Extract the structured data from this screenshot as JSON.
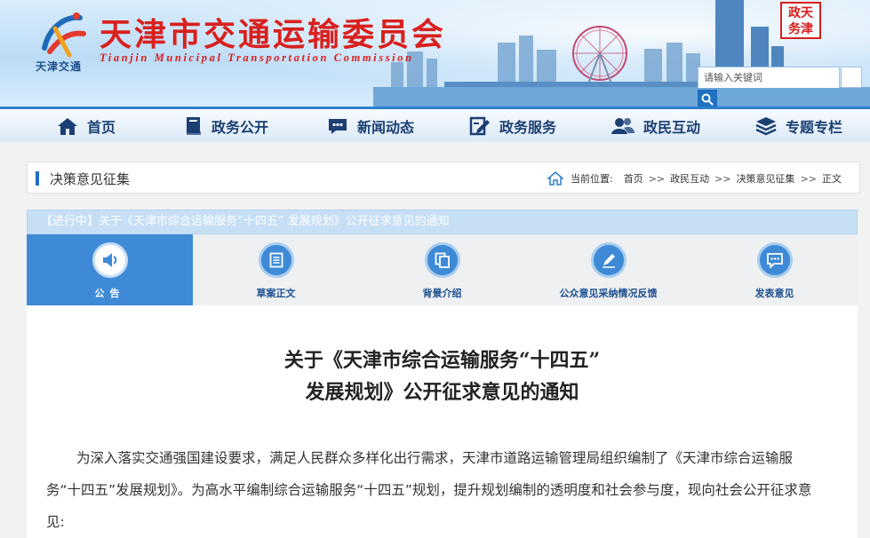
{
  "header": {
    "logo_subtext": "天津交通",
    "title": "天津市交通运输委员会",
    "title_en": "Tianjin Municipal Transportation Commission",
    "seal_text": "天津政务网",
    "search": {
      "placeholder": "请输入关键词",
      "icon": "search-icon"
    }
  },
  "nav": {
    "items": [
      {
        "label": "首页",
        "icon": "home-icon"
      },
      {
        "label": "政务公开",
        "icon": "book-icon"
      },
      {
        "label": "新闻动态",
        "icon": "chat-icon"
      },
      {
        "label": "政务服务",
        "icon": "edit-icon"
      },
      {
        "label": "政民互动",
        "icon": "people-icon"
      },
      {
        "label": "专题专栏",
        "icon": "layers-icon"
      }
    ]
  },
  "breadcrumb": {
    "section_title": "决策意见征集",
    "location_label": "当前位置:",
    "path": [
      "首页",
      "政民互动",
      "决策意见征集",
      "正文"
    ],
    "separator": ">>"
  },
  "notice": {
    "header": "【进行中】关于《天津市综合运输服务“十四五” 发展规划》公开征求意见的通知",
    "tabs": [
      {
        "label": "公告",
        "icon": "speaker-icon",
        "active": true
      },
      {
        "label": "草案正文",
        "icon": "document-icon",
        "active": false
      },
      {
        "label": "背景介绍",
        "icon": "copy-icon",
        "active": false
      },
      {
        "label": "公众意见采纳情况反馈",
        "icon": "pen-icon",
        "active": false
      },
      {
        "label": "发表意见",
        "icon": "comment-icon",
        "active": false
      }
    ],
    "title_line1": "关于《天津市综合运输服务“十四五”",
    "title_line2": "发展规划》公开征求意见的通知",
    "body": "为深入落实交通强国建设要求，满足人民群众多样化出行需求，天津市道路运输管理局组织编制了《天津市综合运输服务“十四五”发展规划》。为高水平编制综合运输服务“十四五”规划，提升规划编制的透明度和社会参与度，现向社会公开征求意见:"
  },
  "colors": {
    "brand_red": "#d9201e",
    "nav_text": "#1b3f73",
    "accent_blue": "#3e8ad6"
  }
}
